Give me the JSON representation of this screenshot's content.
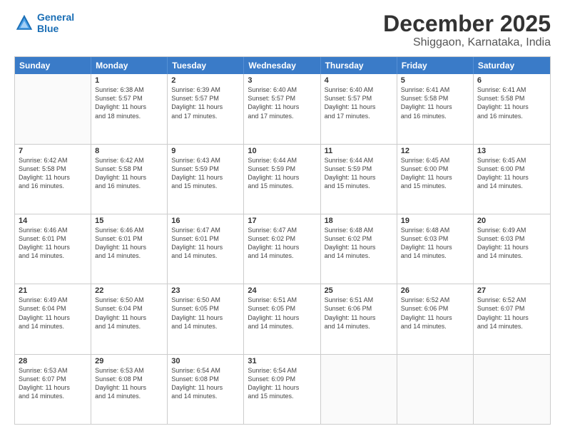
{
  "logo": {
    "line1": "General",
    "line2": "Blue"
  },
  "title": "December 2025",
  "location": "Shiggaon, Karnataka, India",
  "days_of_week": [
    "Sunday",
    "Monday",
    "Tuesday",
    "Wednesday",
    "Thursday",
    "Friday",
    "Saturday"
  ],
  "weeks": [
    [
      {
        "day": "",
        "info": ""
      },
      {
        "day": "1",
        "info": "Sunrise: 6:38 AM\nSunset: 5:57 PM\nDaylight: 11 hours\nand 18 minutes."
      },
      {
        "day": "2",
        "info": "Sunrise: 6:39 AM\nSunset: 5:57 PM\nDaylight: 11 hours\nand 17 minutes."
      },
      {
        "day": "3",
        "info": "Sunrise: 6:40 AM\nSunset: 5:57 PM\nDaylight: 11 hours\nand 17 minutes."
      },
      {
        "day": "4",
        "info": "Sunrise: 6:40 AM\nSunset: 5:57 PM\nDaylight: 11 hours\nand 17 minutes."
      },
      {
        "day": "5",
        "info": "Sunrise: 6:41 AM\nSunset: 5:58 PM\nDaylight: 11 hours\nand 16 minutes."
      },
      {
        "day": "6",
        "info": "Sunrise: 6:41 AM\nSunset: 5:58 PM\nDaylight: 11 hours\nand 16 minutes."
      }
    ],
    [
      {
        "day": "7",
        "info": "Sunrise: 6:42 AM\nSunset: 5:58 PM\nDaylight: 11 hours\nand 16 minutes."
      },
      {
        "day": "8",
        "info": "Sunrise: 6:42 AM\nSunset: 5:58 PM\nDaylight: 11 hours\nand 16 minutes."
      },
      {
        "day": "9",
        "info": "Sunrise: 6:43 AM\nSunset: 5:59 PM\nDaylight: 11 hours\nand 15 minutes."
      },
      {
        "day": "10",
        "info": "Sunrise: 6:44 AM\nSunset: 5:59 PM\nDaylight: 11 hours\nand 15 minutes."
      },
      {
        "day": "11",
        "info": "Sunrise: 6:44 AM\nSunset: 5:59 PM\nDaylight: 11 hours\nand 15 minutes."
      },
      {
        "day": "12",
        "info": "Sunrise: 6:45 AM\nSunset: 6:00 PM\nDaylight: 11 hours\nand 15 minutes."
      },
      {
        "day": "13",
        "info": "Sunrise: 6:45 AM\nSunset: 6:00 PM\nDaylight: 11 hours\nand 14 minutes."
      }
    ],
    [
      {
        "day": "14",
        "info": "Sunrise: 6:46 AM\nSunset: 6:01 PM\nDaylight: 11 hours\nand 14 minutes."
      },
      {
        "day": "15",
        "info": "Sunrise: 6:46 AM\nSunset: 6:01 PM\nDaylight: 11 hours\nand 14 minutes."
      },
      {
        "day": "16",
        "info": "Sunrise: 6:47 AM\nSunset: 6:01 PM\nDaylight: 11 hours\nand 14 minutes."
      },
      {
        "day": "17",
        "info": "Sunrise: 6:47 AM\nSunset: 6:02 PM\nDaylight: 11 hours\nand 14 minutes."
      },
      {
        "day": "18",
        "info": "Sunrise: 6:48 AM\nSunset: 6:02 PM\nDaylight: 11 hours\nand 14 minutes."
      },
      {
        "day": "19",
        "info": "Sunrise: 6:48 AM\nSunset: 6:03 PM\nDaylight: 11 hours\nand 14 minutes."
      },
      {
        "day": "20",
        "info": "Sunrise: 6:49 AM\nSunset: 6:03 PM\nDaylight: 11 hours\nand 14 minutes."
      }
    ],
    [
      {
        "day": "21",
        "info": "Sunrise: 6:49 AM\nSunset: 6:04 PM\nDaylight: 11 hours\nand 14 minutes."
      },
      {
        "day": "22",
        "info": "Sunrise: 6:50 AM\nSunset: 6:04 PM\nDaylight: 11 hours\nand 14 minutes."
      },
      {
        "day": "23",
        "info": "Sunrise: 6:50 AM\nSunset: 6:05 PM\nDaylight: 11 hours\nand 14 minutes."
      },
      {
        "day": "24",
        "info": "Sunrise: 6:51 AM\nSunset: 6:05 PM\nDaylight: 11 hours\nand 14 minutes."
      },
      {
        "day": "25",
        "info": "Sunrise: 6:51 AM\nSunset: 6:06 PM\nDaylight: 11 hours\nand 14 minutes."
      },
      {
        "day": "26",
        "info": "Sunrise: 6:52 AM\nSunset: 6:06 PM\nDaylight: 11 hours\nand 14 minutes."
      },
      {
        "day": "27",
        "info": "Sunrise: 6:52 AM\nSunset: 6:07 PM\nDaylight: 11 hours\nand 14 minutes."
      }
    ],
    [
      {
        "day": "28",
        "info": "Sunrise: 6:53 AM\nSunset: 6:07 PM\nDaylight: 11 hours\nand 14 minutes."
      },
      {
        "day": "29",
        "info": "Sunrise: 6:53 AM\nSunset: 6:08 PM\nDaylight: 11 hours\nand 14 minutes."
      },
      {
        "day": "30",
        "info": "Sunrise: 6:54 AM\nSunset: 6:08 PM\nDaylight: 11 hours\nand 14 minutes."
      },
      {
        "day": "31",
        "info": "Sunrise: 6:54 AM\nSunset: 6:09 PM\nDaylight: 11 hours\nand 15 minutes."
      },
      {
        "day": "",
        "info": ""
      },
      {
        "day": "",
        "info": ""
      },
      {
        "day": "",
        "info": ""
      }
    ]
  ]
}
